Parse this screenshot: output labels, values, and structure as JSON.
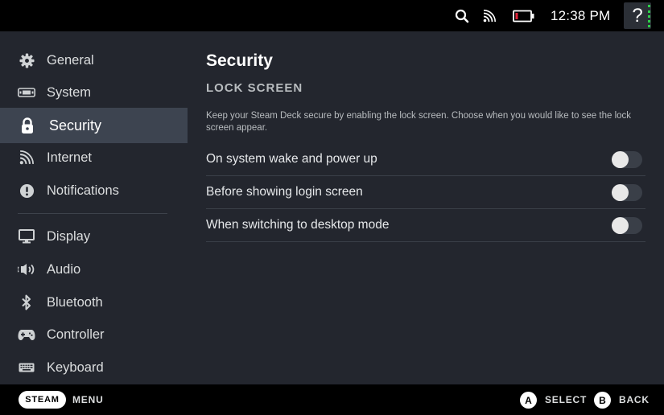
{
  "status_bar": {
    "time": "12:38 PM",
    "help_label": "?",
    "icons": [
      "search-icon",
      "wifi-icon",
      "battery-icon"
    ],
    "battery_color": "#e0243a"
  },
  "sidebar": {
    "items": [
      {
        "label": "General",
        "icon": "gear-icon"
      },
      {
        "label": "System",
        "icon": "system-icon"
      },
      {
        "label": "Security",
        "icon": "lock-icon",
        "active": true
      },
      {
        "label": "Internet",
        "icon": "wifi-icon"
      },
      {
        "label": "Notifications",
        "icon": "alert-icon"
      },
      {
        "label": "Display",
        "icon": "monitor-icon"
      },
      {
        "label": "Audio",
        "icon": "speaker-icon"
      },
      {
        "label": "Bluetooth",
        "icon": "bluetooth-icon"
      },
      {
        "label": "Controller",
        "icon": "gamepad-icon"
      },
      {
        "label": "Keyboard",
        "icon": "keyboard-icon"
      }
    ]
  },
  "main": {
    "title": "Security",
    "section_title": "LOCK SCREEN",
    "description": "Keep your Steam Deck secure by enabling the lock screen. Choose when you would like to see the lock screen appear.",
    "settings": [
      {
        "label": "On system wake and power up",
        "enabled": false
      },
      {
        "label": "Before showing login screen",
        "enabled": false
      },
      {
        "label": "When switching to desktop mode",
        "enabled": false
      }
    ]
  },
  "bottom_bar": {
    "steam_label": "STEAM",
    "menu_label": "MENU",
    "a_glyph": "A",
    "select_label": "SELECT",
    "b_glyph": "B",
    "back_label": "BACK"
  },
  "colors": {
    "background": "#23262e",
    "active_item": "#3d4450",
    "accent_green": "#2fd04a"
  }
}
